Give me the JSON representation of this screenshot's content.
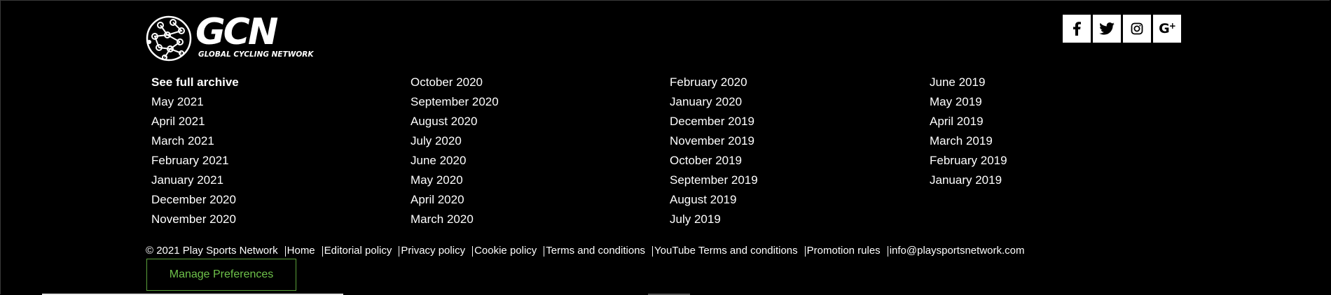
{
  "brand": {
    "logo_text": "GCN",
    "logo_subtext": "GLOBAL CYCLING NETWORK"
  },
  "social": [
    {
      "name": "facebook-icon",
      "glyph": "f"
    },
    {
      "name": "twitter-icon",
      "glyph": "twitter"
    },
    {
      "name": "instagram-icon",
      "glyph": "instagram"
    },
    {
      "name": "google-plus-icon",
      "glyph": "G+"
    }
  ],
  "archive": {
    "columns": [
      [
        "See full archive",
        "May 2021",
        "April 2021",
        "March 2021",
        "February 2021",
        "January 2021",
        "December 2020",
        "November 2020"
      ],
      [
        "October 2020",
        "September 2020",
        "August 2020",
        "July 2020",
        "June 2020",
        "May 2020",
        "April 2020",
        "March 2020"
      ],
      [
        "February 2020",
        "January 2020",
        "December 2019",
        "November 2019",
        "October 2019",
        "September 2019",
        "August 2019",
        "July 2019"
      ],
      [
        "June 2019",
        "May 2019",
        "April 2019",
        "March 2019",
        "February 2019",
        "January 2019"
      ]
    ]
  },
  "footer": {
    "copyright": "© 2021 Play Sports Network",
    "links": [
      "Home",
      "Editorial policy",
      "Privacy policy",
      "Cookie policy",
      "Terms and conditions",
      "YouTube Terms and conditions",
      "Promotion rules",
      "info@playsportsnetwork.com"
    ],
    "manage_label": "Manage Preferences"
  },
  "colors": {
    "background": "#000000",
    "text": "#ffffff",
    "manage_accent": "#6ec24a"
  }
}
